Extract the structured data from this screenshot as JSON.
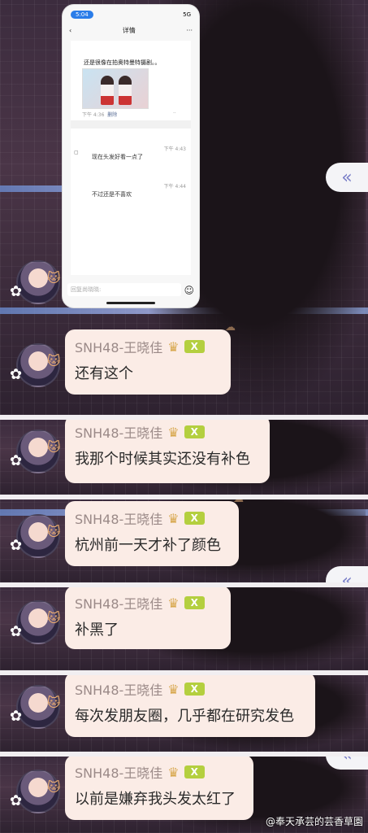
{
  "phone": {
    "status_time": "5:04",
    "status_right": "5G",
    "nav_back": "‹",
    "nav_title": "详情",
    "nav_more": "···",
    "post_text": "还是很像在拍奥特曼特摄剧。。",
    "post_time": "下午 4:36",
    "post_delete": "删除",
    "post_more": "··",
    "replies": [
      {
        "time": "下午 4:43",
        "text": "现在头发好看一点了"
      },
      {
        "time": "下午 4:44",
        "text": "不过还是不喜欢"
      }
    ],
    "input_placeholder": "回复尚晓晓:",
    "emoji_icon": "smile-icon"
  },
  "messages": [
    {
      "sender": "SNH48-王晓佳",
      "badge": "X",
      "text": "还有这个"
    },
    {
      "sender": "SNH48-王晓佳",
      "badge": "X",
      "text": "我那个时候其实还没有补色"
    },
    {
      "sender": "SNH48-王晓佳",
      "badge": "X",
      "text": "杭州前一天才补了颜色"
    },
    {
      "sender": "SNH48-王晓佳",
      "badge": "X",
      "text": "补黑了"
    },
    {
      "sender": "SNH48-王晓佳",
      "badge": "X",
      "text": "每次发朋友圈，几乎都在研究发色"
    },
    {
      "sender": "SNH48-王晓佳",
      "badge": "X",
      "text": "以前是嫌弃我头发太红了"
    }
  ],
  "fold_button": "«",
  "watermark": "@奉天承芸的芸香草園",
  "colors": {
    "bubble_bg": "#fbece6",
    "badge_bg": "#b4cf3f",
    "fold_icon": "#7a7fc8"
  }
}
